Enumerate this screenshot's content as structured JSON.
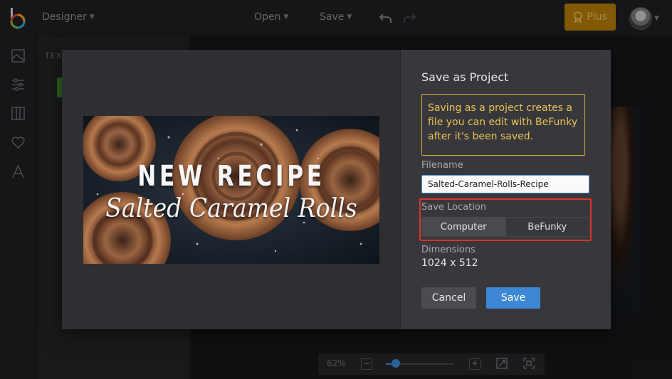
{
  "topbar": {
    "designer_label": "Designer",
    "open_label": "Open",
    "save_label": "Save",
    "plus_label": "Plus"
  },
  "panel": {
    "title": "TEX"
  },
  "zoom": {
    "level": "62%",
    "level_fraction": 0.13
  },
  "preview": {
    "headline": "NEW RECIPE",
    "subtitle": "Salted Caramel Rolls"
  },
  "dialog": {
    "title": "Save as Project",
    "info": "Saving as a project creates a file you can edit with BeFunky after it's been saved.",
    "filename_label": "Filename",
    "filename_value": "Salted-Caramel-Rolls-Recipe",
    "location_label": "Save Location",
    "location_options": [
      "Computer",
      "BeFunky"
    ],
    "location_selected": "Computer",
    "dimensions_label": "Dimensions",
    "dimensions_value": "1024 x 512",
    "cancel_label": "Cancel",
    "save_label": "Save"
  },
  "colors": {
    "accent_blue": "#3d87d4",
    "plus_gold": "#b57c0a",
    "info_yellow": "#e9c455",
    "highlight_red": "#d6352a"
  },
  "icons": [
    "befunky-logo-icon",
    "undo-icon",
    "redo-icon",
    "plus-badge-icon",
    "chevron-down-icon",
    "image-icon",
    "sliders-icon",
    "layout-icon",
    "heart-icon",
    "text-icon",
    "resize-icon",
    "fit-screen-icon"
  ]
}
